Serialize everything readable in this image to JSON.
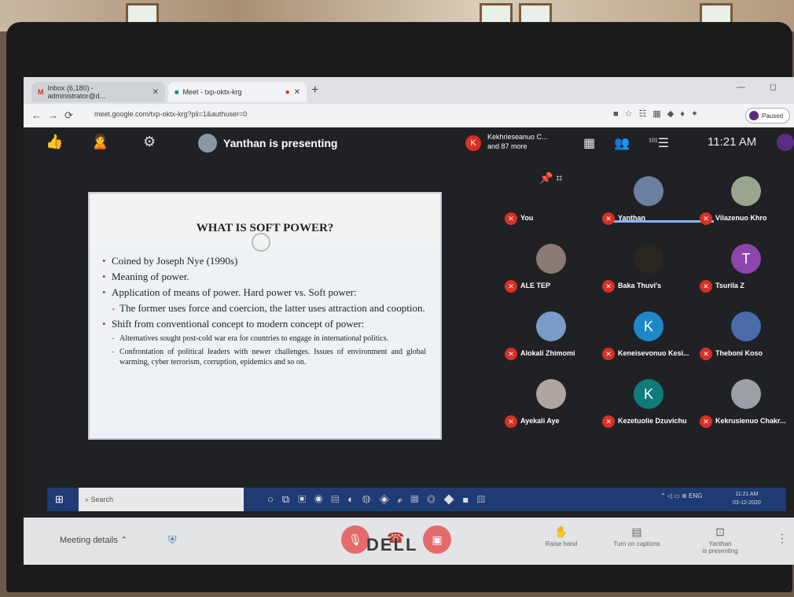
{
  "browser": {
    "tabs": [
      {
        "label": "Inbox (6,180) - administrator@d...",
        "active": false
      },
      {
        "label": "Meet - txp-oktx-krg",
        "active": true
      }
    ],
    "url": "meet.google.com/txp-oktx-krg?pli=1&authuser=0",
    "profile_label": "Paused"
  },
  "meet": {
    "presenter_text": "Yanthan is presenting",
    "participants_summary_initial": "K",
    "participants_summary_line1": "Kekhrieseanuo C...",
    "participants_summary_line2": "and 87 more",
    "participant_count_badge": "101",
    "clock": "11:21 AM",
    "you_label": "You"
  },
  "slide": {
    "title": "WHAT IS SOFT POWER?",
    "bullets": [
      "Coined by Joseph Nye (1990s)",
      "Meaning of power.",
      "Application of means of power. Hard power vs. Soft power:",
      "The former uses force and coercion, the latter uses attraction and cooption.",
      "Shift from conventional concept to modern concept of power:",
      "Alternatives sought post-cold war era for countries to engage in international politics.",
      "Confrontation of political leaders with newer challenges. Issues of environment and global warming, cyber terrorism, corruption, epidemics and so on."
    ]
  },
  "tiles": [
    {
      "name": "You",
      "initial": "",
      "color": "#3c4043"
    },
    {
      "name": "Yanthan",
      "initial": "",
      "color": "#6b7fa0"
    },
    {
      "name": "Vilazenuo Khro",
      "initial": "",
      "color": "#9aa58e"
    },
    {
      "name": "ALE TEP",
      "initial": "",
      "color": "#8a7a74"
    },
    {
      "name": "Baka Thuvi's",
      "initial": "",
      "color": "#2a2620"
    },
    {
      "name": "Tsurila Z",
      "initial": "T",
      "color": "#8e44ad"
    },
    {
      "name": "Alokali Zhimomi",
      "initial": "",
      "color": "#7a9cc8"
    },
    {
      "name": "Keneisevonuo Kesi...",
      "initial": "K",
      "color": "#1e88c7"
    },
    {
      "name": "Theboni Koso",
      "initial": "",
      "color": "#4b6aa8"
    },
    {
      "name": "Ayekali Aye",
      "initial": "",
      "color": "#b0a6a0"
    },
    {
      "name": "Kezetuolie Dzuvichu",
      "initial": "K",
      "color": "#117a7a"
    },
    {
      "name": "Kekrusienuo Chakr...",
      "initial": "",
      "color": "#9aa0a6"
    }
  ],
  "controls": {
    "meeting_details": "Meeting details",
    "raise_hand": "Raise hand",
    "captions": "Turn on captions",
    "presenting_line1": "Yanthan",
    "presenting_line2": "is presenting"
  },
  "taskbar": {
    "search_placeholder": "Search",
    "lang": "ENG",
    "time": "11:21 AM",
    "date": "03-12-2020"
  },
  "brand": "DELL"
}
